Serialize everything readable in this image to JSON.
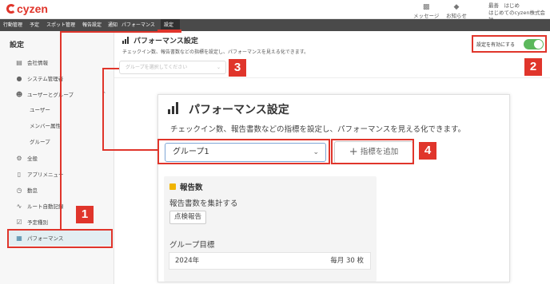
{
  "app": {
    "logo_text": "cyzen"
  },
  "header": {
    "message_label": "メッセージ",
    "notice_label": "お知らせ",
    "user_name": "最善　はじめ",
    "company": "はじめてのcyzen株式会社"
  },
  "nav": {
    "items": [
      {
        "label": "行動管理"
      },
      {
        "label": "予定"
      },
      {
        "label": "スポット管理"
      },
      {
        "label": "報告設定"
      },
      {
        "label": "通知"
      },
      {
        "label": "パフォーマンス"
      },
      {
        "label": "設定"
      }
    ]
  },
  "sidebar": {
    "title": "設定",
    "items": [
      {
        "label": "会社情報",
        "icon": "building-icon"
      },
      {
        "label": "システム管理者",
        "icon": "admin-icon"
      },
      {
        "label": "ユーザーとグループ",
        "icon": "user-icon"
      },
      {
        "label": "ユーザー"
      },
      {
        "label": "メンバー属性"
      },
      {
        "label": "グループ"
      },
      {
        "label": "全般",
        "icon": "gear-icon"
      },
      {
        "label": "アプリメニュー",
        "icon": "phone-icon"
      },
      {
        "label": "勤怠",
        "icon": "clock-icon"
      },
      {
        "label": "ルート自動記録",
        "icon": "route-icon"
      },
      {
        "label": "予定種別",
        "icon": "calendar-check-icon"
      },
      {
        "label": "パフォーマンス",
        "icon": "bar-chart-icon"
      }
    ]
  },
  "main": {
    "title": "パフォーマンス設定",
    "description": "チェックイン数、報告書数などの指標を設定し、パフォーマンスを見える化できます。",
    "toggle_label": "設定を有効にする",
    "toggle_on": true,
    "group_placeholder": "グループを選択してください"
  },
  "zoom": {
    "title": "パフォーマンス設定",
    "description": "チェックイン数、報告書数などの指標を設定し、パフォーマンスを見える化できます。",
    "group_value": "グループ1",
    "add_button": "指標を追加",
    "card": {
      "title": "報告数",
      "title_color": "#f0b400",
      "text": "報告書数を集計する",
      "tag": "点検報告",
      "goal_label": "グループ目標",
      "goal_year": "2024年",
      "goal_value": "毎月 30 枚"
    }
  },
  "callouts": [
    "1",
    "2",
    "3",
    "4"
  ],
  "colors": {
    "accent_red": "#e0352b",
    "toggle_green": "#5cb85c",
    "nav_bg": "#4a4a4a"
  }
}
